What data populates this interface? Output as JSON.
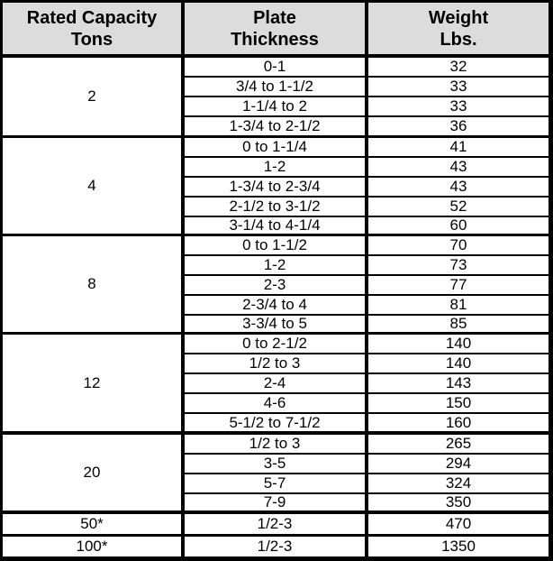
{
  "table": {
    "headers": [
      {
        "line1": "Rated Capacity",
        "line2": "Tons"
      },
      {
        "line1": "Plate",
        "line2": "Thickness"
      },
      {
        "line1": "Weight",
        "line2": "Lbs."
      }
    ],
    "groups": [
      {
        "capacity": "2",
        "rows": [
          {
            "thickness": "0-1",
            "weight": "32"
          },
          {
            "thickness": "3/4 to 1-1/2",
            "weight": "33"
          },
          {
            "thickness": "1-1/4 to 2",
            "weight": "33"
          },
          {
            "thickness": "1-3/4 to 2-1/2",
            "weight": "36"
          }
        ]
      },
      {
        "capacity": "4",
        "rows": [
          {
            "thickness": "0 to 1-1/4",
            "weight": "41"
          },
          {
            "thickness": "1-2",
            "weight": "43"
          },
          {
            "thickness": "1-3/4 to 2-3/4",
            "weight": "43"
          },
          {
            "thickness": "2-1/2 to 3-1/2",
            "weight": "52"
          },
          {
            "thickness": "3-1/4 to 4-1/4",
            "weight": "60"
          }
        ]
      },
      {
        "capacity": "8",
        "rows": [
          {
            "thickness": "0 to 1-1/2",
            "weight": "70"
          },
          {
            "thickness": "1-2",
            "weight": "73"
          },
          {
            "thickness": "2-3",
            "weight": "77"
          },
          {
            "thickness": "2-3/4 to 4",
            "weight": "81"
          },
          {
            "thickness": "3-3/4 to 5",
            "weight": "85"
          }
        ]
      },
      {
        "capacity": "12",
        "rows": [
          {
            "thickness": "0 to 2-1/2",
            "weight": "140"
          },
          {
            "thickness": "1/2 to 3",
            "weight": "140"
          },
          {
            "thickness": "2-4",
            "weight": "143"
          },
          {
            "thickness": "4-6",
            "weight": "150"
          },
          {
            "thickness": "5-1/2 to 7-1/2",
            "weight": "160"
          }
        ]
      },
      {
        "capacity": "20",
        "rows": [
          {
            "thickness": "1/2 to 3",
            "weight": "265"
          },
          {
            "thickness": "3-5",
            "weight": "294"
          },
          {
            "thickness": "5-7",
            "weight": "324"
          },
          {
            "thickness": "7-9",
            "weight": "350"
          }
        ]
      },
      {
        "capacity": "50*",
        "rows": [
          {
            "thickness": "1/2-3",
            "weight": "470"
          }
        ]
      },
      {
        "capacity": "100*",
        "rows": [
          {
            "thickness": "1/2-3",
            "weight": "1350"
          }
        ]
      }
    ]
  }
}
